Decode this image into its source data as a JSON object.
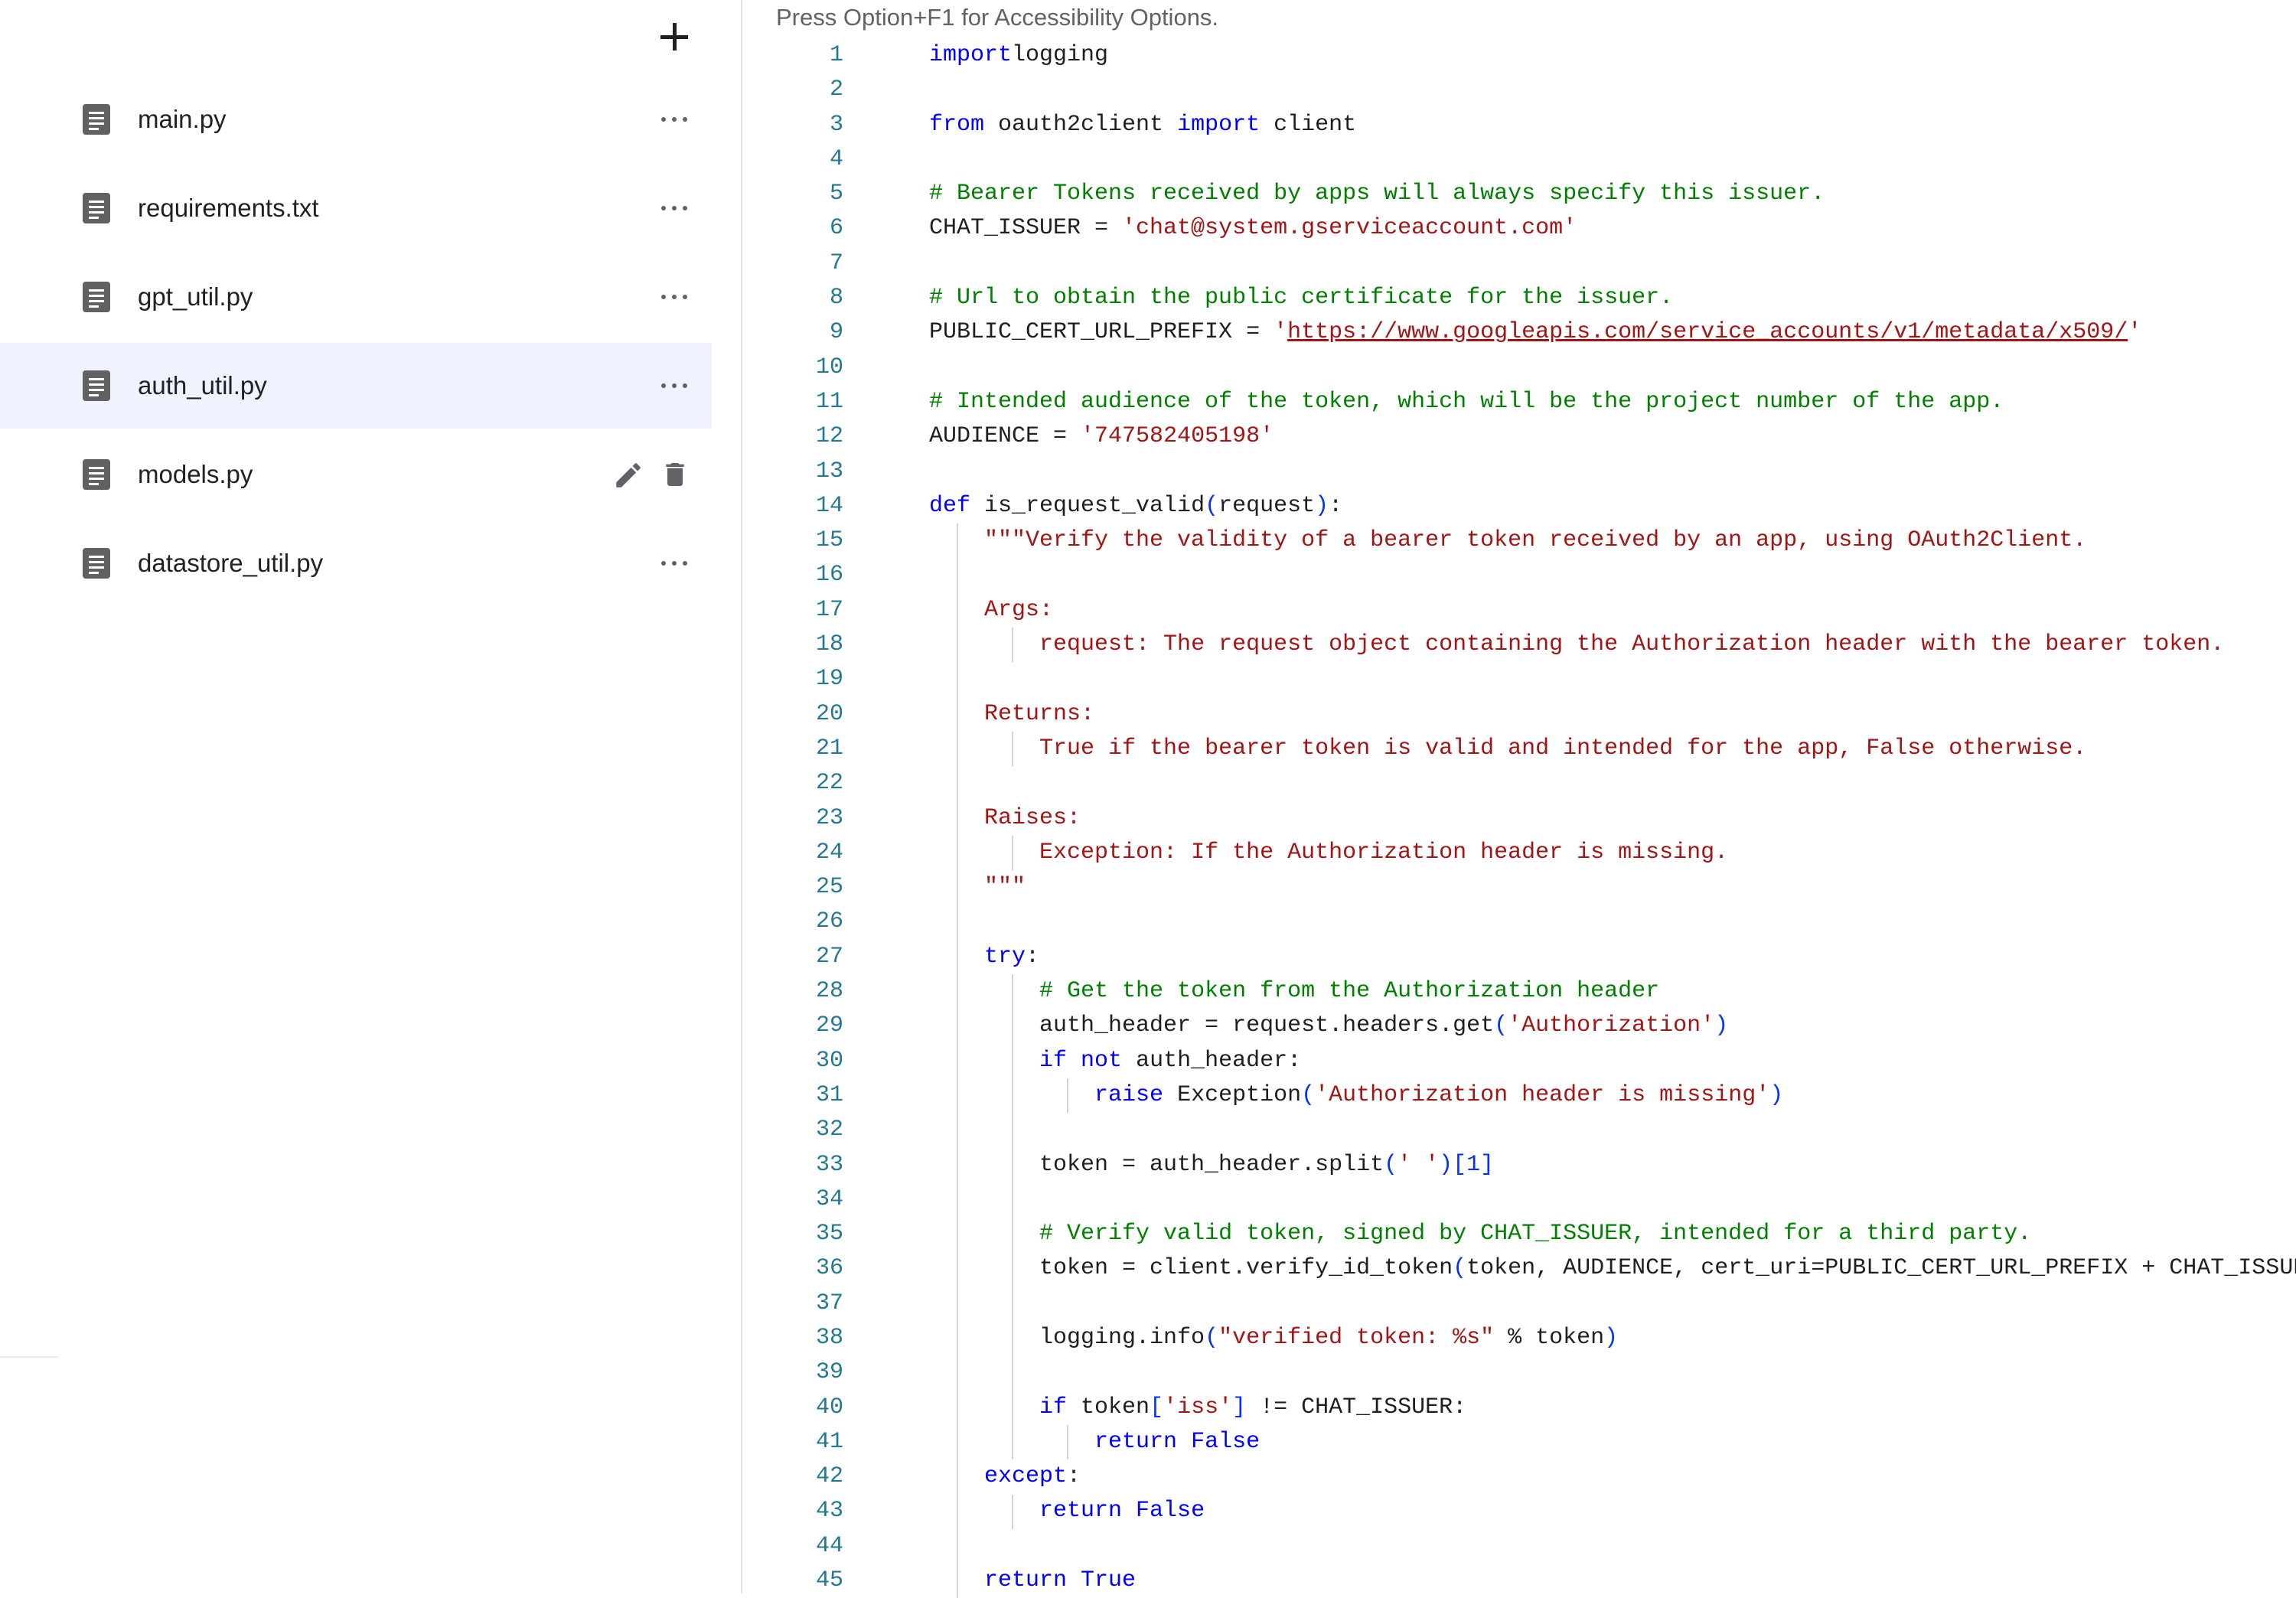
{
  "sidebar": {
    "add_button_icon": "plus-icon",
    "files": [
      {
        "name": "main.py",
        "selected": false,
        "action": "more"
      },
      {
        "name": "requirements.txt",
        "selected": false,
        "action": "more"
      },
      {
        "name": "gpt_util.py",
        "selected": false,
        "action": "more"
      },
      {
        "name": "auth_util.py",
        "selected": true,
        "action": "more"
      },
      {
        "name": "models.py",
        "selected": false,
        "action": "edit-delete"
      },
      {
        "name": "datastore_util.py",
        "selected": false,
        "action": "more"
      }
    ]
  },
  "editor": {
    "accessibility_hint": "Press Option+F1 for Accessibility Options.",
    "lines": [
      {
        "n": "1",
        "t": [
          [
            "kw",
            "import"
          ],
          [
            "",
            "logging"
          ]
        ]
      },
      {
        "n": "2",
        "t": []
      },
      {
        "n": "3",
        "t": [
          [
            "kw",
            "from"
          ],
          [
            "",
            " oauth2client "
          ],
          [
            "kw",
            "import"
          ],
          [
            "",
            " client"
          ]
        ]
      },
      {
        "n": "4",
        "t": []
      },
      {
        "n": "5",
        "t": [
          [
            "cm",
            "# Bearer Tokens received by apps will always specify this issuer."
          ]
        ]
      },
      {
        "n": "6",
        "t": [
          [
            "",
            "CHAT_ISSUER = "
          ],
          [
            "st",
            "'chat@system.gserviceaccount.com'"
          ]
        ]
      },
      {
        "n": "7",
        "t": []
      },
      {
        "n": "8",
        "t": [
          [
            "cm",
            "# Url to obtain the public certificate for the issuer."
          ]
        ]
      },
      {
        "n": "9",
        "t": [
          [
            "",
            "PUBLIC_CERT_URL_PREFIX = "
          ],
          [
            "st",
            "'"
          ],
          [
            "url",
            "https://www.googleapis.com/service_accounts/v1/metadata/x509/"
          ],
          [
            "st",
            "'"
          ]
        ]
      },
      {
        "n": "10",
        "t": []
      },
      {
        "n": "11",
        "t": [
          [
            "cm",
            "# Intended audience of the token, which will be the project number of the app."
          ]
        ]
      },
      {
        "n": "12",
        "t": [
          [
            "",
            "AUDIENCE = "
          ],
          [
            "st",
            "'747582405198'"
          ]
        ]
      },
      {
        "n": "13",
        "t": []
      },
      {
        "n": "14",
        "t": [
          [
            "kw",
            "def"
          ],
          [
            "",
            " is_request_valid"
          ],
          [
            "pn",
            "("
          ],
          [
            "",
            "request"
          ],
          [
            "pn",
            ")"
          ],
          [
            "",
            ":"
          ]
        ]
      },
      {
        "n": "15",
        "t": [
          [
            "",
            "    "
          ],
          [
            "st",
            "\"\"\"Verify the validity of a bearer token received by an app, using OAuth2Client."
          ]
        ]
      },
      {
        "n": "16",
        "t": []
      },
      {
        "n": "17",
        "t": [
          [
            "",
            "    "
          ],
          [
            "st",
            "Args:"
          ]
        ]
      },
      {
        "n": "18",
        "t": [
          [
            "",
            "        "
          ],
          [
            "st",
            "request: The request object containing the Authorization header with the bearer token."
          ]
        ]
      },
      {
        "n": "19",
        "t": []
      },
      {
        "n": "20",
        "t": [
          [
            "",
            "    "
          ],
          [
            "st",
            "Returns:"
          ]
        ]
      },
      {
        "n": "21",
        "t": [
          [
            "",
            "        "
          ],
          [
            "st",
            "True if the bearer token is valid and intended for the app, False otherwise."
          ]
        ]
      },
      {
        "n": "22",
        "t": []
      },
      {
        "n": "23",
        "t": [
          [
            "",
            "    "
          ],
          [
            "st",
            "Raises:"
          ]
        ]
      },
      {
        "n": "24",
        "t": [
          [
            "",
            "        "
          ],
          [
            "st",
            "Exception: If the Authorization header is missing."
          ]
        ]
      },
      {
        "n": "25",
        "t": [
          [
            "",
            "    "
          ],
          [
            "st",
            "\"\"\""
          ]
        ]
      },
      {
        "n": "26",
        "t": []
      },
      {
        "n": "27",
        "t": [
          [
            "",
            "    "
          ],
          [
            "kw",
            "try"
          ],
          [
            "",
            ":"
          ]
        ]
      },
      {
        "n": "28",
        "t": [
          [
            "",
            "        "
          ],
          [
            "cm",
            "# Get the token from the Authorization header"
          ]
        ]
      },
      {
        "n": "29",
        "t": [
          [
            "",
            "        auth_header = request.headers.get"
          ],
          [
            "pn",
            "("
          ],
          [
            "st",
            "'Authorization'"
          ],
          [
            "pn",
            ")"
          ]
        ]
      },
      {
        "n": "30",
        "t": [
          [
            "",
            "        "
          ],
          [
            "kw",
            "if not"
          ],
          [
            "",
            " auth_header:"
          ]
        ]
      },
      {
        "n": "31",
        "t": [
          [
            "",
            "            "
          ],
          [
            "kw",
            "raise"
          ],
          [
            "",
            " Exception"
          ],
          [
            "pn",
            "("
          ],
          [
            "st",
            "'Authorization header is missing'"
          ],
          [
            "pn",
            ")"
          ]
        ]
      },
      {
        "n": "32",
        "t": []
      },
      {
        "n": "33",
        "t": [
          [
            "",
            "        token = auth_header.split"
          ],
          [
            "pn",
            "("
          ],
          [
            "st",
            "' '"
          ],
          [
            "pn",
            ")[1]"
          ]
        ]
      },
      {
        "n": "34",
        "t": []
      },
      {
        "n": "35",
        "t": [
          [
            "",
            "        "
          ],
          [
            "cm",
            "# Verify valid token, signed by CHAT_ISSUER, intended for a third party."
          ]
        ]
      },
      {
        "n": "36",
        "t": [
          [
            "",
            "        token = client.verify_id_token"
          ],
          [
            "pn",
            "("
          ],
          [
            "",
            "token, AUDIENCE, cert_uri=PUBLIC_CERT_URL_PREFIX + CHAT_ISSUER"
          ],
          [
            "pn",
            ")"
          ]
        ]
      },
      {
        "n": "37",
        "t": []
      },
      {
        "n": "38",
        "t": [
          [
            "",
            "        logging.info"
          ],
          [
            "pn",
            "("
          ],
          [
            "st",
            "\"verified token: %s\""
          ],
          [
            "",
            " % token"
          ],
          [
            "pn",
            ")"
          ]
        ]
      },
      {
        "n": "39",
        "t": []
      },
      {
        "n": "40",
        "t": [
          [
            "",
            "        "
          ],
          [
            "kw",
            "if"
          ],
          [
            "",
            " token"
          ],
          [
            "pn",
            "["
          ],
          [
            "st",
            "'iss'"
          ],
          [
            "pn",
            "]"
          ],
          [
            "",
            " != CHAT_ISSUER:"
          ]
        ]
      },
      {
        "n": "41",
        "t": [
          [
            "",
            "            "
          ],
          [
            "kw",
            "return False"
          ]
        ]
      },
      {
        "n": "42",
        "t": [
          [
            "",
            "    "
          ],
          [
            "kw",
            "except"
          ],
          [
            "",
            ":"
          ]
        ]
      },
      {
        "n": "43",
        "t": [
          [
            "",
            "        "
          ],
          [
            "kw",
            "return False"
          ]
        ]
      },
      {
        "n": "44",
        "t": []
      },
      {
        "n": "45",
        "t": [
          [
            "",
            "    "
          ],
          [
            "kw",
            "return True"
          ]
        ]
      }
    ]
  }
}
